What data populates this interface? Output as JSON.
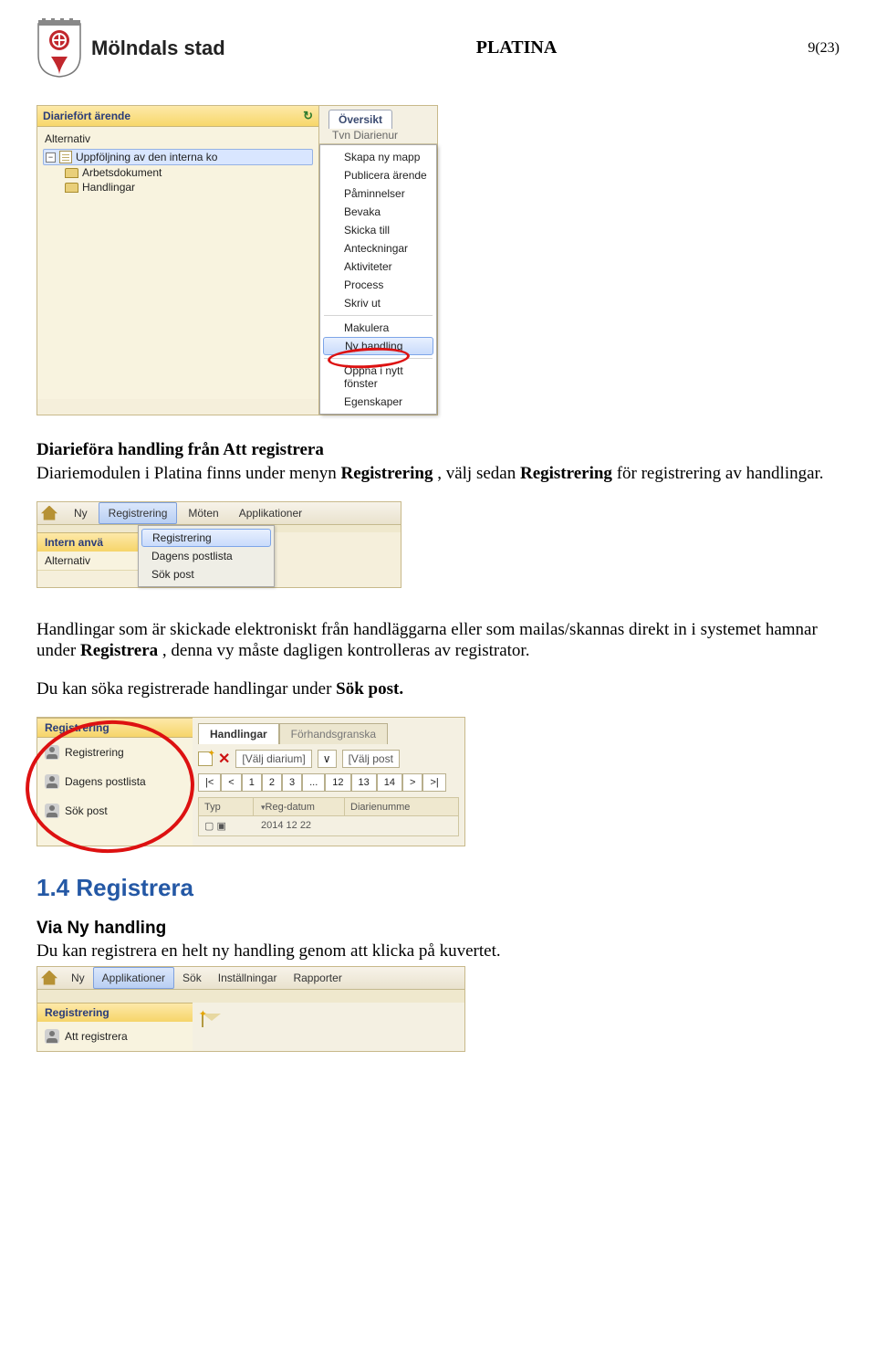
{
  "header": {
    "org_name": "Mölndals stad",
    "doc_title": "PLATINA",
    "page_number": "9(23)"
  },
  "shot1": {
    "panel_title": "Diariefört ärende",
    "refresh_aria": "refresh",
    "alternativ": "Alternativ",
    "selected_item": "Uppföljning av den interna ko",
    "folder1": "Arbetsdokument",
    "folder2": "Handlingar",
    "tab": "Översikt",
    "faint": "Tvn   Diarienur",
    "menu": {
      "skapa": "Skapa ny mapp",
      "publicera": "Publicera ärende",
      "paminnelser": "Påminnelser",
      "bevaka": "Bevaka",
      "skicka": "Skicka till",
      "anteckningar": "Anteckningar",
      "aktiviteter": "Aktiviteter",
      "process": "Process",
      "skriv": "Skriv ut",
      "makulera": "Makulera",
      "nyhandling": "Ny handling",
      "oppna": "Öppna i nytt fönster",
      "egenskaper": "Egenskaper"
    }
  },
  "para1": {
    "heading": "Diarieföra handling från Att registrera",
    "text_a": "Diariemodulen i Platina finns under menyn ",
    "bold_a": "Registrering",
    "text_b": ", välj sedan ",
    "bold_b": "Registrering",
    "text_c": " för registrering av handlingar."
  },
  "shot2": {
    "menu": {
      "ny": "Ny",
      "registrering": "Registrering",
      "moten": "Möten",
      "applikationer": "Applikationer"
    },
    "dropdown": {
      "registrering": "Registrering",
      "dagens": "Dagens postlista",
      "sok": "Sök post"
    },
    "orange1": "Intern anvä",
    "pale1": "Alternativ"
  },
  "para2": {
    "text_a": "Handlingar som är skickade elektroniskt från handläggarna eller som mailas/skannas direkt in i systemet hamnar under ",
    "bold_a": "Registrera",
    "text_b": ", denna vy måste dagligen kontrolleras av registrator."
  },
  "para3": {
    "text_a": "Du kan söka registrerade handlingar under ",
    "bold_a": "Sök post.",
    "text_b": ""
  },
  "shot3": {
    "band": "Registrering",
    "left": {
      "reg": "Registrering",
      "dagens": "Dagens postlista",
      "sok": "Sök post"
    },
    "tabs": {
      "handlingar": "Handlingar",
      "forhands": "Förhandsgranska"
    },
    "toolbar": {
      "valjdiarium": "[Välj diarium]",
      "valjpost": "[Välj post"
    },
    "pager": {
      "first": "|<",
      "prev": "<",
      "one": "1",
      "two": "2",
      "three": "3",
      "dots": "...",
      "twelve": "12",
      "thirteen": "13",
      "fourteen": "14",
      "next": ">",
      "last": ">|"
    },
    "grid": {
      "typ": "Typ",
      "regdatum": "Reg-datum",
      "diarie": "Diarienumme"
    },
    "date": "2014 12 22"
  },
  "h14": "1.4   Registrera",
  "via": {
    "heading": "Via Ny handling",
    "text": "Du kan registrera en helt ny handling genom att klicka på kuvertet."
  },
  "shot4": {
    "menu": {
      "ny": "Ny",
      "applikationer": "Applikationer",
      "sok": "Sök",
      "installningar": "Inställningar",
      "rapporter": "Rapporter"
    },
    "band": "Registrering",
    "left": "Att registrera"
  }
}
